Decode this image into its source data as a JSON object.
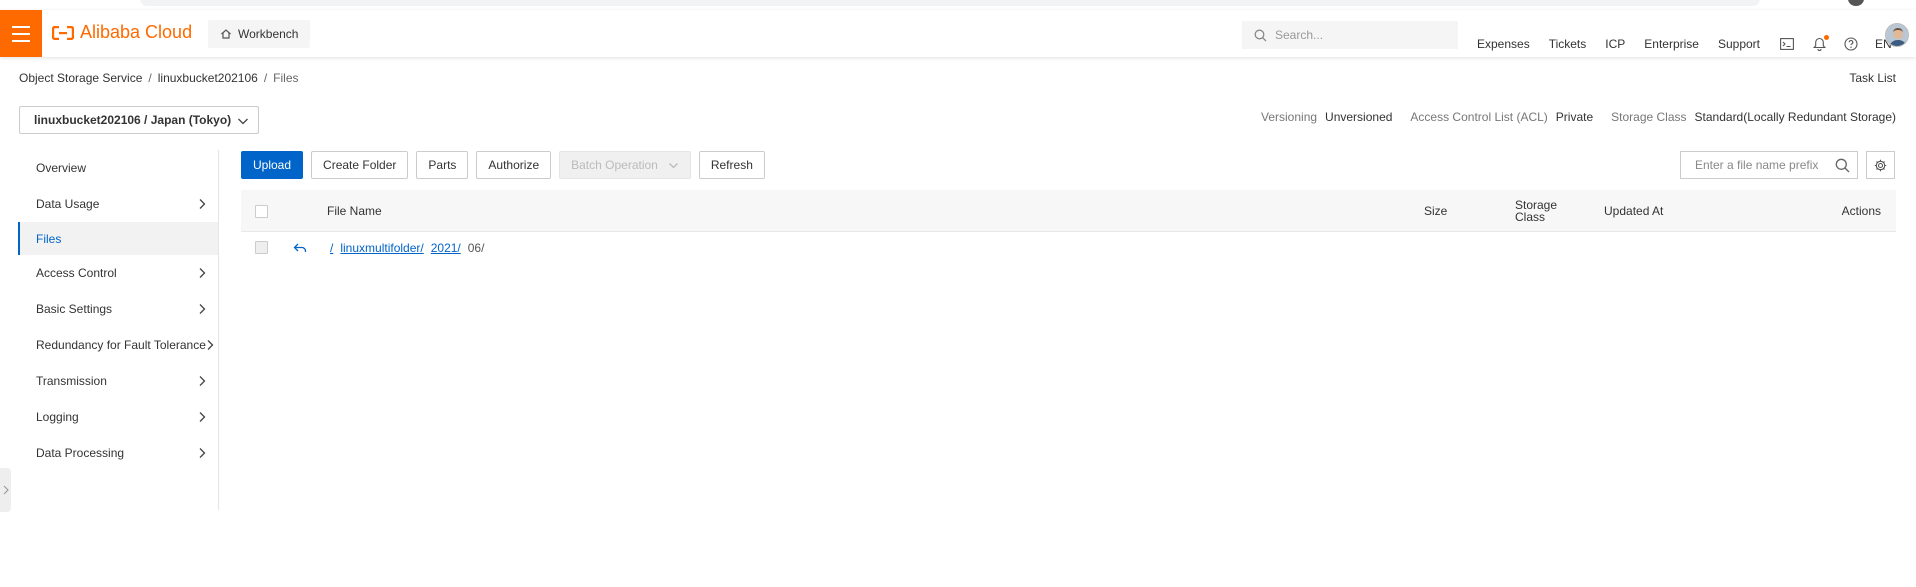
{
  "topbar": {
    "logo_text": "Alibaba Cloud",
    "workbench_label": "Workbench",
    "search_placeholder": "Search...",
    "nav": [
      "Expenses",
      "Tickets",
      "ICP",
      "Enterprise",
      "Support"
    ],
    "language": "EN"
  },
  "breadcrumb": {
    "items": [
      "Object Storage Service",
      "linuxbucket202106",
      "Files"
    ],
    "separator": "/"
  },
  "task_list_label": "Task List",
  "bucket": {
    "selector_label": "linuxbucket202106 / Japan (Tokyo)",
    "versioning_label": "Versioning",
    "versioning_value": "Unversioned",
    "acl_label": "Access Control List (ACL)",
    "acl_value": "Private",
    "storage_class_label": "Storage Class",
    "storage_class_value": "Standard(Locally Redundant Storage)"
  },
  "sidebar": {
    "items": [
      {
        "label": "Overview",
        "has_arrow": false
      },
      {
        "label": "Data Usage",
        "has_arrow": true
      },
      {
        "label": "Files",
        "has_arrow": false,
        "active": true
      },
      {
        "label": "Access Control",
        "has_arrow": true
      },
      {
        "label": "Basic Settings",
        "has_arrow": true
      },
      {
        "label": "Redundancy for Fault Tolerance",
        "has_arrow": true
      },
      {
        "label": "Transmission",
        "has_arrow": true
      },
      {
        "label": "Logging",
        "has_arrow": true
      },
      {
        "label": "Data Processing",
        "has_arrow": true
      }
    ]
  },
  "toolbar": {
    "upload": "Upload",
    "create_folder": "Create Folder",
    "parts": "Parts",
    "authorize": "Authorize",
    "batch_operation": "Batch Operation",
    "refresh": "Refresh",
    "prefix_placeholder": "Enter a file name prefix"
  },
  "table": {
    "headers": {
      "file_name": "File Name",
      "size": "Size",
      "storage_class_line1": "Storage",
      "storage_class_line2": "Class",
      "updated_at": "Updated At",
      "actions": "Actions"
    },
    "path_row": {
      "root": "/",
      "segments": [
        "linuxmultifolder/",
        "2021/"
      ],
      "current": "06/"
    }
  },
  "colors": {
    "brand": "#ff6a00",
    "primary": "#0064c8"
  }
}
